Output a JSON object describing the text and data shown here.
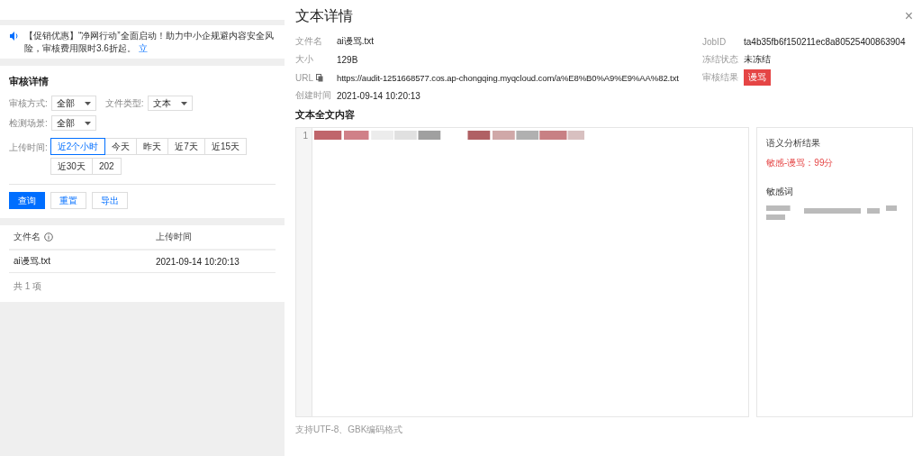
{
  "banner": {
    "text": "【促销优惠】“净网行动”全面启动！助力中小企规避内容安全风险，审核费用限时3.6折起。",
    "link": "立"
  },
  "audit": {
    "title": "审核详情",
    "filters": [
      {
        "label": "审核方式:",
        "value": "全部"
      },
      {
        "label": "文件类型:",
        "value": "文本"
      },
      {
        "label": "检测场景:",
        "value": "全部"
      }
    ],
    "time_label": "上传时间:",
    "time_options": [
      {
        "label": "近2个小时",
        "selected": true
      },
      {
        "label": "今天",
        "selected": false
      },
      {
        "label": "昨天",
        "selected": false
      },
      {
        "label": "近7天",
        "selected": false
      },
      {
        "label": "近15天",
        "selected": false
      },
      {
        "label": "近30天",
        "selected": false
      },
      {
        "label": "202",
        "selected": false
      }
    ],
    "buttons": [
      {
        "label": "查询",
        "kind": "primary"
      },
      {
        "label": "重置",
        "kind": "default"
      },
      {
        "label": "导出",
        "kind": "default"
      }
    ]
  },
  "table": {
    "columns": [
      "文件名",
      "上传时间"
    ],
    "rows": [
      [
        "ai谩骂.txt",
        "2021-09-14 10:20:13"
      ]
    ],
    "total": "共 1 项"
  },
  "drawer": {
    "title": "文本详情",
    "close": "×",
    "left_fields": [
      {
        "label": "文件名",
        "value": "ai谩骂.txt"
      },
      {
        "label": "大小",
        "value": "129B"
      },
      {
        "label": "URL",
        "value": "https://audit-1251668577.cos.ap-chongqing.myqcloud.com/a%E8%B0%A9%E9%AA%82.txt",
        "kind": "copy"
      },
      {
        "label": "创建时间",
        "value": "2021-09-14 10:20:13"
      }
    ],
    "right_fields": [
      {
        "label": "JobID",
        "value": "ta4b35fb6f150211ec8a80525400863904"
      },
      {
        "label": "冻结状态",
        "value": "未冻结"
      },
      {
        "label": "审核结果",
        "value": "谩骂",
        "kind": "tag"
      }
    ],
    "content_title": "文本全文内容",
    "line_numbers": [
      "1"
    ],
    "analysis": {
      "title": "语义分析结果",
      "result": "敏感-谩骂：99分",
      "keywords_title": "敏感词"
    },
    "footnote": "支持UTF-8、GBK编码格式"
  }
}
